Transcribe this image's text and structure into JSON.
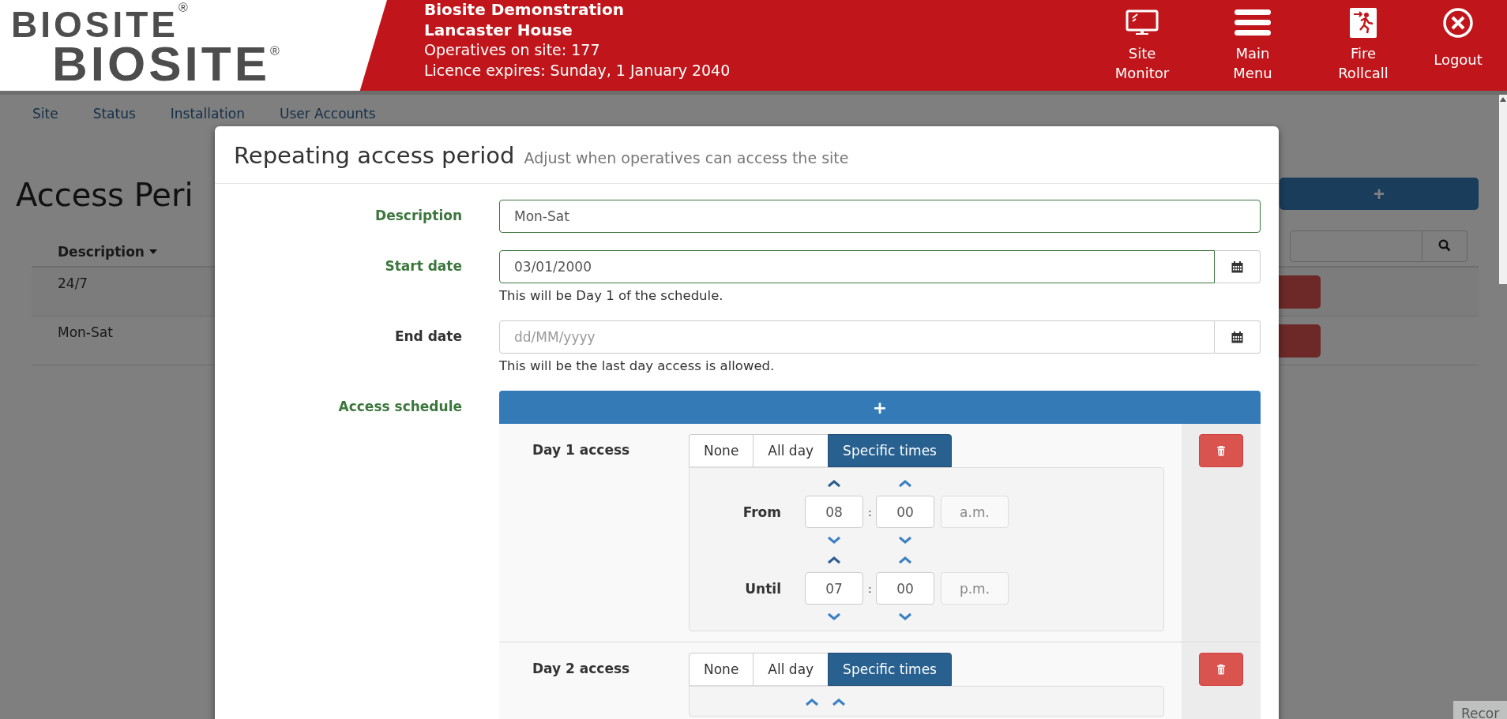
{
  "header": {
    "logos": [
      "BIOSITE$^{®}$",
      "BIOSITE$^{®}$"
    ],
    "site": {
      "titles": [
        "Biosite Demonstration",
        "Lancaster House"
      ],
      "lines": [
        "Operatives on site: 177",
        "Licence expires: Sunday, 1 January 2040"
      ]
    },
    "actions": [
      {
        "kind": "monitor",
        "label": "Site\nMonitor"
      },
      {
        "kind": "menu",
        "label": "Main\nMenu"
      },
      {
        "kind": "fire",
        "label": "Fire\nRollcall"
      },
      {
        "kind": "logout",
        "label": "Logout"
      }
    ]
  },
  "nav": [
    {
      "label": "Site"
    },
    {
      "label": "Status"
    },
    {
      "label": "Installation"
    },
    {
      "label": "User Accounts"
    }
  ],
  "page": {
    "title": "Access Peri",
    "add_button": "+",
    "column": "Description",
    "rows": [
      "24/7",
      "Mon-Sat"
    ]
  },
  "modal": {
    "title": "Repeating access period",
    "subtitle": "Adjust when operatives can access the site",
    "fields": [
      {
        "label": "Description",
        "value": "Mon-Sat",
        "valid": true
      },
      {
        "label": "Start date",
        "value": "03/01/2000",
        "valid": true,
        "calendar": true,
        "help": "This will be Day 1 of the schedule."
      },
      {
        "label": "End date",
        "placeholder": "dd/MM/yyyy",
        "valid": false,
        "calendar": true,
        "help": "This will be the last day access is allowed."
      }
    ],
    "schedule": {
      "label": "Access schedule",
      "valid": true,
      "add_button": "+",
      "days": [
        {
          "label": "Day 1 access",
          "options": [
            {
              "label": "None",
              "selected": false
            },
            {
              "label": "All day",
              "selected": false
            },
            {
              "label": "Specific times",
              "selected": true
            }
          ],
          "times": [
            {
              "label": "From",
              "hour": "08",
              "separator": ":",
              "minute": "00",
              "period": "a.m."
            },
            {
              "label": "Until",
              "hour": "07",
              "separator": ":",
              "minute": "00",
              "period": "p.m."
            }
          ]
        },
        {
          "label": "Day 2 access",
          "options": [
            {
              "label": "None",
              "selected": false
            },
            {
              "label": "All day",
              "selected": false
            },
            {
              "label": "Specific times",
              "selected": true
            }
          ]
        }
      ]
    }
  },
  "tooltip": "Recor"
}
